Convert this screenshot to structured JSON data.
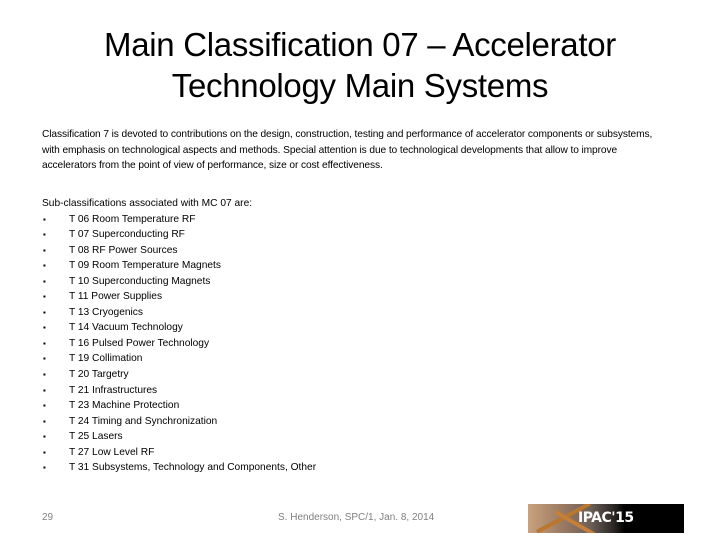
{
  "slide": {
    "title": "Main Classification 07 – Accelerator Technology Main Systems",
    "intro": "Classification 7 is devoted to contributions on the design, construction, testing and performance of  accelerator components or subsystems, with emphasis on technological aspects and methods. Special attention is due  to technological developments that allow to improve accelerators from the point of view of performance, size or  cost effectiveness.",
    "sub_heading": "Sub-classifications associated with MC 07 are:",
    "bullet_glyph": "▪",
    "sub_classifications": [
      "T 06 Room Temperature RF",
      "T 07 Superconducting RF",
      "T 08 RF Power Sources",
      "T 09 Room Temperature Magnets",
      "T 10 Superconducting Magnets",
      "T 11 Power Supplies",
      "T 13 Cryogenics",
      "T 14 Vacuum Technology",
      "T 16 Pulsed Power Technology",
      "T 19 Collimation",
      "T 20 Targetry",
      "T 21 Infrastructures",
      "T 23 Machine Protection",
      "T 24 Timing and Synchronization",
      "T 25 Lasers",
      "T 27 Low Level RF",
      "T 31 Subsystems, Technology and Components,  Other"
    ]
  },
  "footer": {
    "page_number": "29",
    "attribution": "S. Henderson, SPC/1, Jan. 8, 2014",
    "logo_text": "IPAC'15"
  }
}
